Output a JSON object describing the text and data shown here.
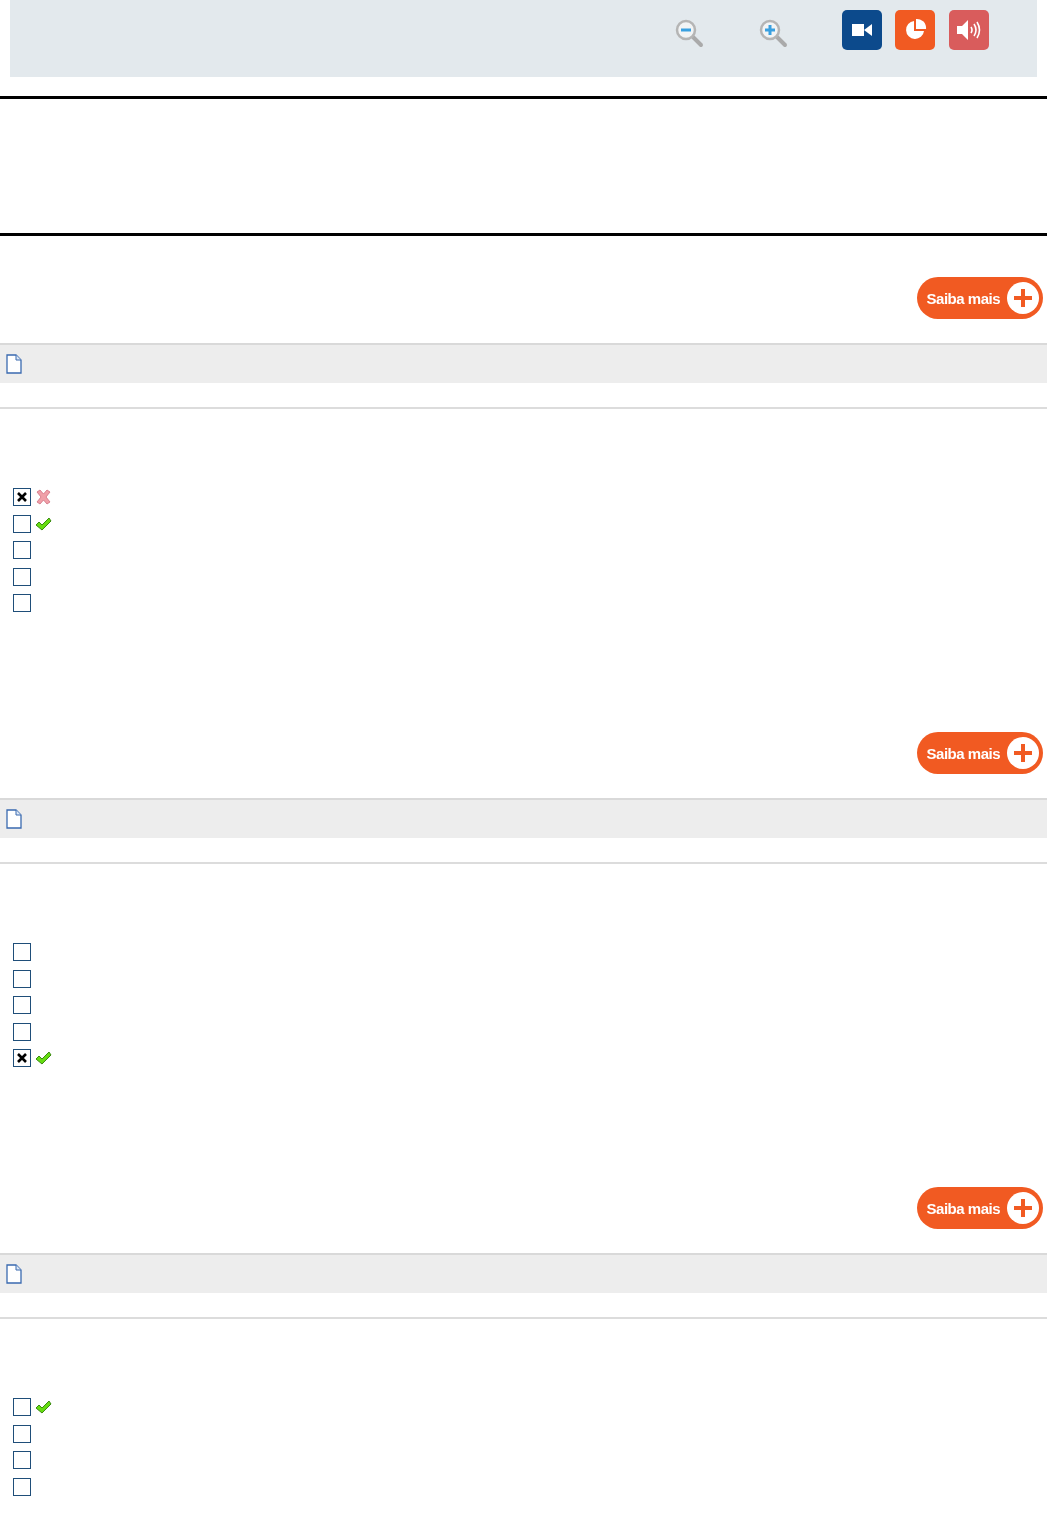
{
  "toolbar": {
    "buttons": [
      {
        "kind": "zoom-out"
      },
      {
        "kind": "zoom-in"
      },
      {
        "kind": "video"
      },
      {
        "kind": "chart"
      },
      {
        "kind": "audio"
      }
    ]
  },
  "questions": [
    {
      "button": "Saiba mais",
      "options": [
        {
          "checked": true,
          "kind": "wrong"
        },
        {
          "checked": false,
          "kind": "correct"
        },
        {
          "checked": false,
          "kind": "plain"
        },
        {
          "checked": false,
          "kind": "plain"
        },
        {
          "checked": false,
          "kind": "plain"
        }
      ]
    },
    {
      "button": "Saiba mais",
      "options": [
        {
          "checked": false,
          "kind": "plain"
        },
        {
          "checked": false,
          "kind": "plain"
        },
        {
          "checked": false,
          "kind": "plain"
        },
        {
          "checked": false,
          "kind": "plain"
        },
        {
          "checked": true,
          "kind": "correct"
        }
      ]
    },
    {
      "button": "Saiba mais",
      "options": [
        {
          "checked": false,
          "kind": "correct"
        },
        {
          "checked": false,
          "kind": "plain"
        },
        {
          "checked": false,
          "kind": "plain"
        },
        {
          "checked": false,
          "kind": "plain"
        }
      ]
    }
  ]
}
